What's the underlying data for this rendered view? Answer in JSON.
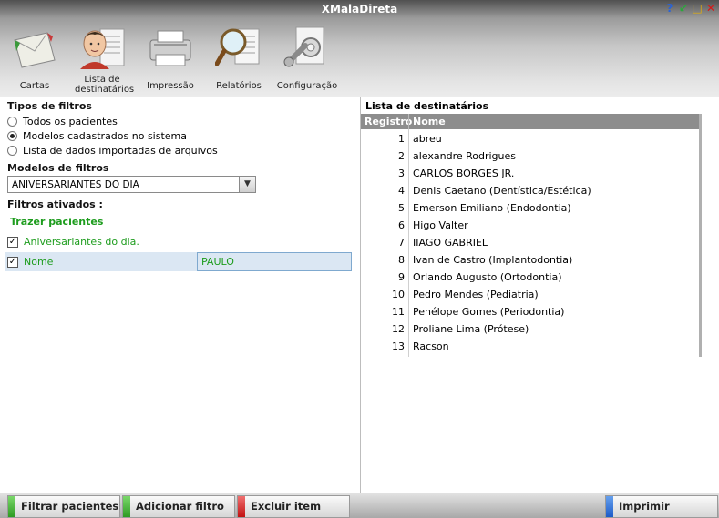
{
  "window": {
    "title": "XMalaDireta",
    "controls": [
      "?",
      "↙",
      "□",
      "✕"
    ]
  },
  "toolbar": [
    {
      "label": "Cartas",
      "icon": "envelope-icon"
    },
    {
      "label": "Lista de destinatários",
      "icon": "person-icon"
    },
    {
      "label": "Impressão",
      "icon": "printer-icon"
    },
    {
      "label": "Relatórios",
      "icon": "magnifier-icon"
    },
    {
      "label": "Configuração",
      "icon": "wrench-gear-icon"
    }
  ],
  "filters": {
    "types_title": "Tipos de filtros",
    "types": [
      {
        "label": "Todos os pacientes",
        "selected": false
      },
      {
        "label": "Modelos cadastrados no sistema",
        "selected": true
      },
      {
        "label": "Lista de dados importadas de arquivos",
        "selected": false
      }
    ],
    "models_title": "Modelos de filtros",
    "model_selected": "ANIVERSARIANTES DO DIA",
    "active_title": "Filtros ativados :",
    "fetch_heading": "Trazer pacientes",
    "birthday_filter": "Aniversariantes do dia.",
    "name_filter_label": "Nome",
    "name_filter_value": "PAULO"
  },
  "recipients": {
    "title": "Lista de destinatários",
    "columns": [
      "Registro",
      "Nome"
    ],
    "rows": [
      {
        "reg": "1",
        "name": "abreu"
      },
      {
        "reg": "2",
        "name": "alexandre Rodrigues"
      },
      {
        "reg": "3",
        "name": "CARLOS BORGES JR."
      },
      {
        "reg": "4",
        "name": "Denis Caetano (Dentística/Estética)"
      },
      {
        "reg": "5",
        "name": "Emerson Emiliano (Endodontia)"
      },
      {
        "reg": "6",
        "name": "Higo Valter"
      },
      {
        "reg": "7",
        "name": "IIAGO GABRIEL"
      },
      {
        "reg": "8",
        "name": "Ivan de Castro (Implantodontia)"
      },
      {
        "reg": "9",
        "name": "Orlando Augusto (Ortodontia)"
      },
      {
        "reg": "10",
        "name": "Pedro Mendes (Pediatria)"
      },
      {
        "reg": "11",
        "name": "Penélope Gomes (Periodontia)"
      },
      {
        "reg": "12",
        "name": "Proliane Lima (Prótese)"
      },
      {
        "reg": "13",
        "name": "Racson"
      }
    ]
  },
  "bottom": {
    "filter_btn": "Filtrar pacientes",
    "add_btn": "Adicionar filtro",
    "delete_btn": "Excluir item",
    "print_btn": "Imprimir"
  }
}
